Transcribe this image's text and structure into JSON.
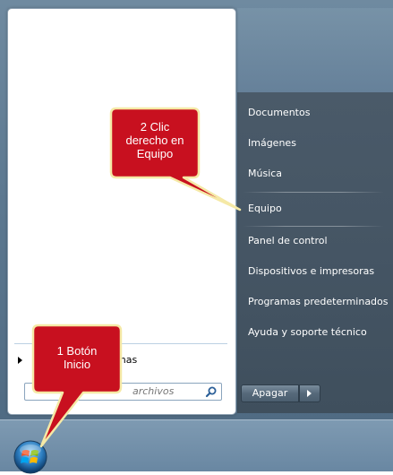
{
  "start_menu": {
    "all_programs_label": "mas",
    "search_placeholder": "archivos",
    "right_items": [
      "Documentos",
      "Imágenes",
      "Música",
      "Equipo",
      "Panel de control",
      "Dispositivos e impresoras",
      "Programas predeterminados",
      "Ayuda y soporte técnico"
    ],
    "shutdown_label": "Apagar"
  },
  "callouts": {
    "step2_line1": "2 Clic",
    "step2_line2": "derecho en",
    "step2_line3": "Equipo",
    "step1_line1": "1 Botón",
    "step1_line2": "Inicio"
  },
  "colors": {
    "callout_fill": "#c8101f",
    "callout_stroke": "#f5e9a6"
  },
  "icons": {
    "search": "search-icon",
    "orb": "windows-start-orb-icon",
    "arrow": "right-arrow-icon"
  }
}
